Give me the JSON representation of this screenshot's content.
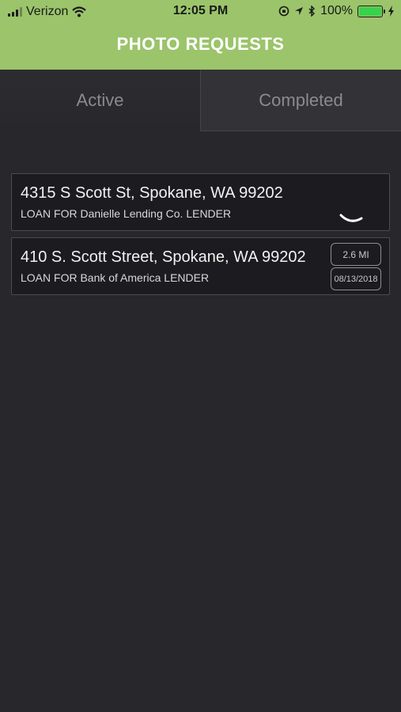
{
  "status_bar": {
    "carrier": "Verizon",
    "time": "12:05 PM",
    "battery": "100%"
  },
  "header": {
    "title": "PHOTO REQUESTS"
  },
  "tabs": [
    {
      "label": "Active",
      "selected": true
    },
    {
      "label": "Completed",
      "selected": false
    }
  ],
  "requests": [
    {
      "address": "4315 S Scott St, Spokane, WA 99202",
      "lender": "LOAN FOR Danielle Lending Co. LENDER",
      "loading": true
    },
    {
      "address": "410 S. Scott Street, Spokane, WA 99202",
      "lender": "LOAN FOR Bank of America LENDER",
      "distance": "2.6 MI",
      "date": "08/13/2018"
    }
  ],
  "colors": {
    "header_bg": "#9bc46b",
    "page_bg": "#27272c",
    "battery_fill": "#3ad14d"
  }
}
